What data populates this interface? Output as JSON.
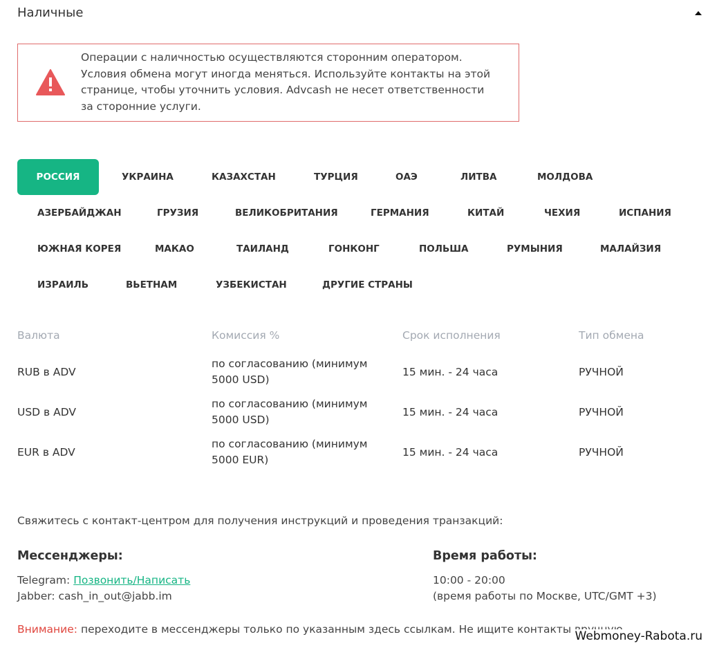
{
  "section": {
    "title": "Наличные"
  },
  "warning": {
    "line1": "Операции с наличностью осуществляются сторонним оператором.",
    "line2": "Условия обмена могут иногда меняться. Используйте контакты на этой",
    "line3": "странице, чтобы уточнить условия. Advcash не несет ответственности",
    "line4": "за сторонние услуги."
  },
  "countries": [
    "РОССИЯ",
    "УКРАИНА",
    "КАЗАХСТАН",
    "ТУРЦИЯ",
    "ОАЭ",
    "ЛИТВА",
    "МОЛДОВА",
    "АЗЕРБАЙДЖАН",
    "ГРУЗИЯ",
    "ВЕЛИКОБРИТАНИЯ",
    "ГЕРМАНИЯ",
    "КИТАЙ",
    "ЧЕХИЯ",
    "ИСПАНИЯ",
    "ЮЖНАЯ КОРЕЯ",
    "МАКАО",
    "ТАИЛАНД",
    "ГОНКОНГ",
    "ПОЛЬША",
    "РУМЫНИЯ",
    "МАЛАЙЗИЯ",
    "ИЗРАИЛЬ",
    "ВЬЕТНАМ",
    "УЗБЕКИСТАН",
    "ДРУГИЕ СТРАНЫ"
  ],
  "table": {
    "headers": [
      "Валюта",
      "Комиссия %",
      "Срок исполнения",
      "Тип обмена"
    ],
    "rows": [
      {
        "currency": "RUB в ADV",
        "commission_1": "по согласованию (минимум",
        "commission_2": "5000 USD)",
        "time": "15 мин. - 24 часа",
        "type": "РУЧНОЙ"
      },
      {
        "currency": "USD в ADV",
        "commission_1": "по согласованию (минимум",
        "commission_2": "5000 USD)",
        "time": "15 мин. - 24 часа",
        "type": "РУЧНОЙ"
      },
      {
        "currency": "EUR в ADV",
        "commission_1": "по согласованию (минимум",
        "commission_2": "5000 EUR)",
        "time": "15 мин. - 24 часа",
        "type": "РУЧНОЙ"
      }
    ]
  },
  "contact": {
    "intro": "Свяжитесь с контакт-центром для получения инструкций и проведения транзакций:",
    "messengers_title": "Мессенджеры:",
    "telegram_label": "Telegram:",
    "telegram_link": "Позвонить/Написать",
    "jabber": "Jabber: cash_in_out@jabb.im",
    "hours_title": "Время работы:",
    "hours": "10:00 - 20:00",
    "hours_note": "(время работы по Москве, UTC/GMT +3)"
  },
  "attention": {
    "label": "Внимание:",
    "text": "переходите в мессенджеры только по указанным здесь ссылкам. Не ищите контакты вручную."
  },
  "watermark": "Webmoney-Rabota.ru",
  "colors": {
    "accent": "#16b584",
    "warning_border": "#e06b6b",
    "warning_icon": "#e8585a",
    "attention": "#e0463e",
    "header_gray": "#a3a9b2"
  },
  "icons": {
    "collapse": "caret-up-icon",
    "warning": "warning-triangle-icon"
  }
}
